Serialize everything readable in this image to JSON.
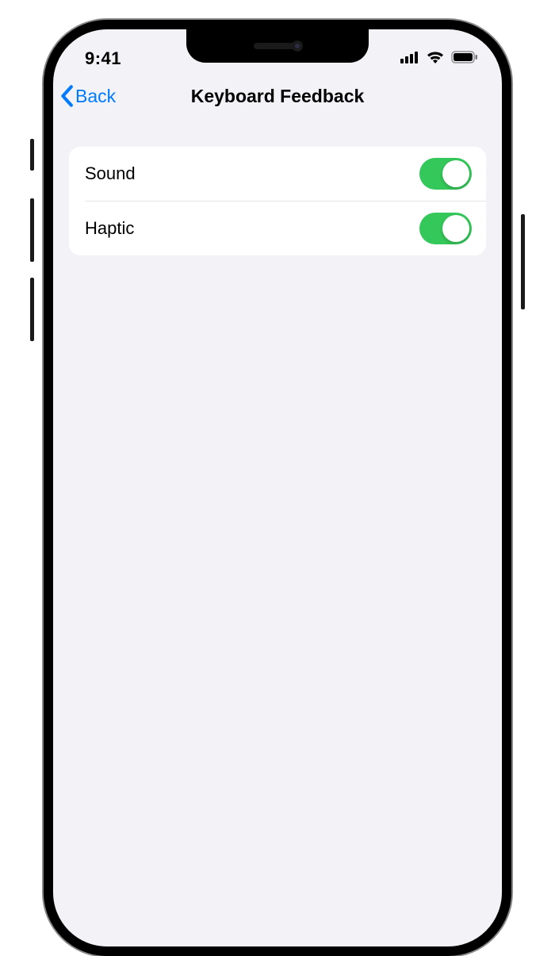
{
  "status": {
    "time": "9:41"
  },
  "nav": {
    "back_label": "Back",
    "title": "Keyboard Feedback"
  },
  "settings": {
    "items": [
      {
        "label": "Sound",
        "enabled": true
      },
      {
        "label": "Haptic",
        "enabled": true
      }
    ]
  },
  "colors": {
    "tint": "#007aff",
    "toggle_on": "#34c759",
    "background": "#f2f2f7"
  }
}
